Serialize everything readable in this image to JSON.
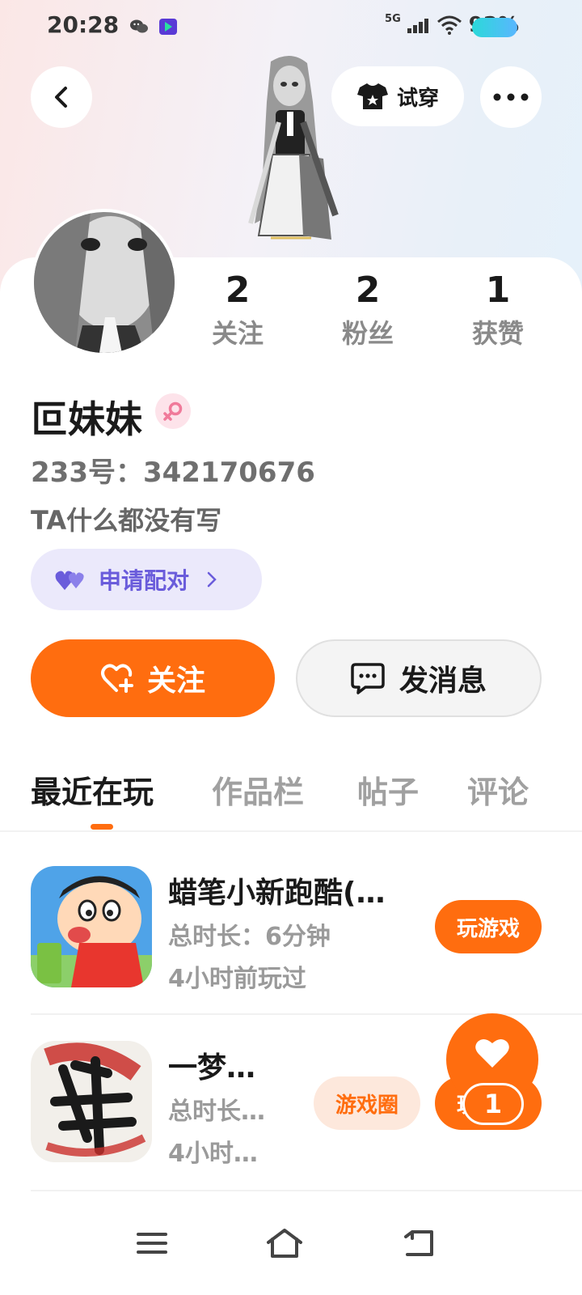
{
  "status_bar": {
    "time": "20:28",
    "network": "5G",
    "battery": "92%",
    "battery_color": "#2bd9d9"
  },
  "header": {
    "back_icon": "chevron-left-icon",
    "try_on_label": "试穿",
    "try_on_icon": "tshirt-icon",
    "more_icon": "more-dots-icon"
  },
  "profile": {
    "username": "叵妹妹",
    "gender_icon": "female-icon",
    "id_label": "233号：342170676",
    "bio": "TA什么都没有写",
    "pair_button": "申请配对"
  },
  "stats": [
    {
      "value": "2",
      "label": "关注"
    },
    {
      "value": "2",
      "label": "粉丝"
    },
    {
      "value": "1",
      "label": "获赞"
    }
  ],
  "actions": {
    "follow_label": "关注",
    "message_label": "发消息"
  },
  "tabs": [
    {
      "label": "最近在玩",
      "active": true
    },
    {
      "label": "作品栏",
      "active": false
    },
    {
      "label": "帖子",
      "active": false
    },
    {
      "label": "评论",
      "active": false
    }
  ],
  "games": [
    {
      "title": "蜡笔小新跑酷(…",
      "duration": "总时长：6分钟",
      "last_played": "4小时前玩过",
      "play_label": "玩游戏"
    },
    {
      "title": "一梦…",
      "duration": "总时长…",
      "last_played": "4小时…",
      "circle_label": "游戏圈",
      "play_label": "玩游戏"
    }
  ],
  "like_fab": {
    "count": "1",
    "icon": "heart-icon"
  },
  "colors": {
    "accent": "#ff6d0f",
    "pair_purple": "#6a5cdb"
  }
}
